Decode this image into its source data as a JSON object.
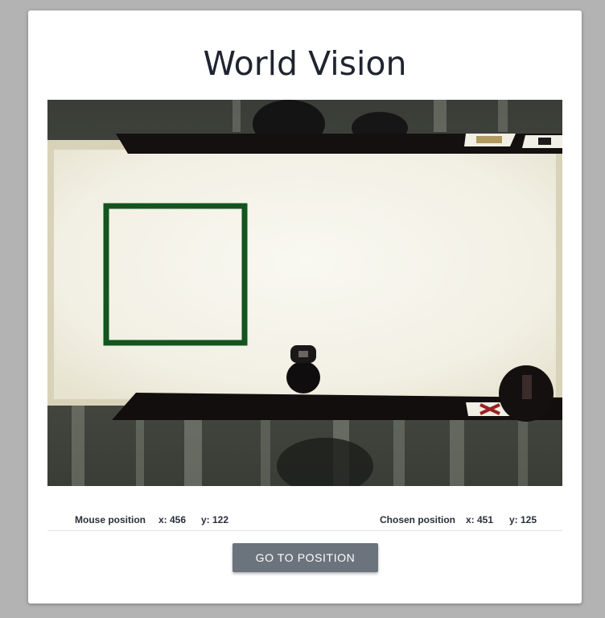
{
  "page": {
    "title": "World Vision"
  },
  "camera_view": {
    "kind": "top-down camera feed"
  },
  "mouse_position": {
    "label": "Mouse position",
    "x_text": "x: 456",
    "y_text": "y: 122"
  },
  "chosen_position": {
    "label": "Chosen position",
    "x_text": "x: 451",
    "y_text": "y: 125"
  },
  "actions": {
    "go_to_position_label": "GO TO POSITION"
  },
  "colors": {
    "page_background": "#b3b3b3",
    "card_background": "#ffffff",
    "title_text": "#1f2430",
    "button_background": "#6b737d",
    "button_text": "#ffffff",
    "target_square": "#14541f",
    "board_surface": "#f4f2e8"
  }
}
